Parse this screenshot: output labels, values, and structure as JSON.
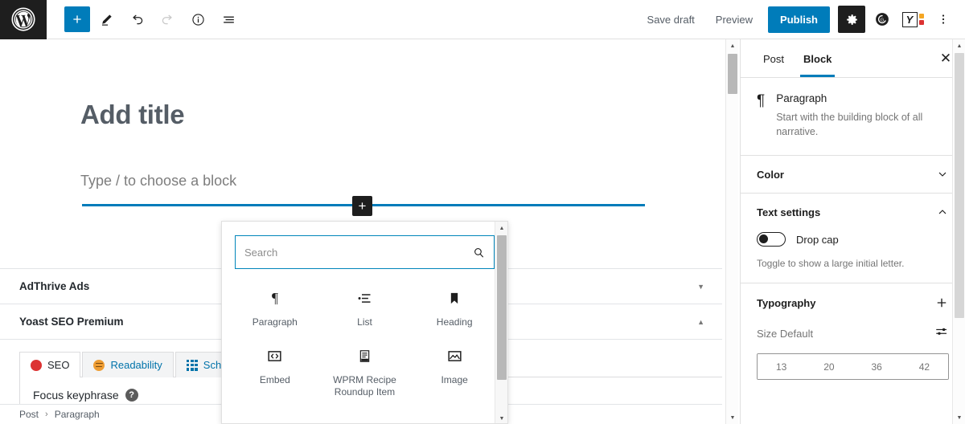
{
  "topbar": {
    "logo_icon": "wordpress-logo-icon",
    "left_tools": [
      {
        "name": "block-inserter-toggle",
        "icon": "plus-icon",
        "label": "+",
        "state": "primary"
      },
      {
        "name": "tools-pencil",
        "icon": "pencil-icon",
        "label": "",
        "state": "default"
      },
      {
        "name": "undo",
        "icon": "undo-icon",
        "label": "",
        "state": "default"
      },
      {
        "name": "redo",
        "icon": "redo-icon",
        "label": "",
        "state": "disabled"
      },
      {
        "name": "details-info",
        "icon": "info-icon",
        "label": "",
        "state": "default"
      },
      {
        "name": "list-view",
        "icon": "list-view-icon",
        "label": "",
        "state": "default"
      }
    ],
    "save_draft_label": "Save draft",
    "preview_label": "Preview",
    "publish_label": "Publish",
    "settings_icon": "gear-icon",
    "grammarly_icon": "grammarly-icon",
    "yoast_letter": "Y",
    "more_menu_icon": "vertical-ellipsis-icon",
    "accent_blue": "#007cba"
  },
  "editor": {
    "title_placeholder": "Add title",
    "block_placeholder": "Type / to choose a block",
    "insert_plus_label": "+",
    "meta_panels": [
      {
        "title": "AdThrive Ads",
        "expanded": false,
        "caret": "▼"
      },
      {
        "title": "Yoast SEO Premium",
        "expanded": true,
        "caret": "▲"
      }
    ],
    "yoast": {
      "tabs": [
        {
          "label": "SEO",
          "icon": "red-dot-icon",
          "active": true
        },
        {
          "label": "Readability",
          "icon": "neutral-face-icon",
          "active": false
        },
        {
          "label": "Schema",
          "icon": "grid-icon",
          "active": false
        }
      ],
      "focus_keyphrase_label": "Focus keyphrase",
      "help_icon": "question-mark-icon"
    },
    "breadcrumb": {
      "root": "Post",
      "separator": "›",
      "current": "Paragraph"
    }
  },
  "inserter": {
    "search_placeholder": "Search",
    "search_value": "",
    "search_icon": "magnifier-icon",
    "blocks": [
      {
        "label": "Paragraph",
        "icon": "paragraph-icon"
      },
      {
        "label": "List",
        "icon": "list-icon"
      },
      {
        "label": "Heading",
        "icon": "heading-bookmark-icon"
      },
      {
        "label": "Embed",
        "icon": "code-embed-icon"
      },
      {
        "label": "WPRM Recipe Roundup Item",
        "icon": "recipe-document-icon"
      },
      {
        "label": "Image",
        "icon": "image-icon"
      }
    ]
  },
  "sidebar": {
    "tabs": [
      {
        "label": "Post",
        "active": false
      },
      {
        "label": "Block",
        "active": true
      }
    ],
    "close_label": "✕",
    "block_info": {
      "icon": "paragraph-icon",
      "title": "Paragraph",
      "description": "Start with the building block of all narrative."
    },
    "sections": [
      {
        "title": "Color",
        "control": "chevron-down-icon",
        "control_glyph": "⌄"
      },
      {
        "title": "Text settings",
        "control": "chevron-up-icon",
        "control_glyph": "⌃"
      },
      {
        "title": "Typography",
        "control": "plus-icon",
        "control_glyph": "+"
      }
    ],
    "text_settings": {
      "drop_cap_label": "Drop cap",
      "drop_cap_on": false,
      "helper_text": "Toggle to show a large initial letter."
    },
    "typography": {
      "size_label": "Size Default",
      "size_controls_icon": "sliders-icon",
      "sizes": [
        "13",
        "20",
        "36",
        "42"
      ]
    }
  }
}
